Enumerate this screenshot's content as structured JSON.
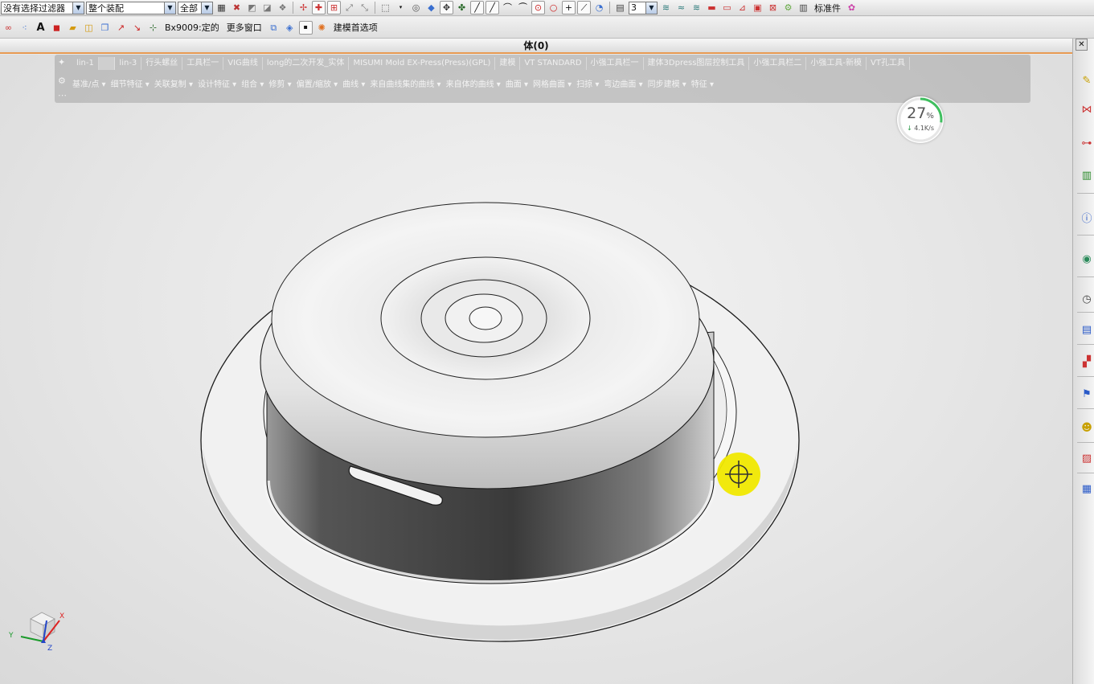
{
  "toolbar1": {
    "filter_value": "没有选择过滤器",
    "assembly_value": "整个装配",
    "scope_value": "全部",
    "layer_value": "3",
    "standard_parts_label": "标准件"
  },
  "toolbar2": {
    "macro_label": "Bx9009:定的",
    "more_windows_label": "更多窗口",
    "modeling_prefs_label": "建模首选项"
  },
  "window": {
    "title": "体(0)"
  },
  "ribbon": {
    "tabs": [
      "lin-1",
      "lin-3",
      "行头螺丝",
      "工具栏一",
      "VIG曲线",
      "long的二次开发_实体",
      "MISUMI Mold EX-Press(Press)(GPL)",
      "建模",
      "VT STANDARD",
      "小强工具栏一",
      "建体3Dpress图层控制工具",
      "小强工具栏二",
      "小强工具-新模",
      "VT孔工具"
    ],
    "groups": [
      "基准/点 ▾",
      "细节特征 ▾",
      "关联复制 ▾",
      "设计特征 ▾",
      "组合 ▾",
      "修剪 ▾",
      "偏置/缩放 ▾",
      "曲线 ▾",
      "来自曲线集的曲线 ▾",
      "来自体的曲线 ▾",
      "曲面 ▾",
      "网格曲面 ▾",
      "扫掠 ▾",
      "弯边曲面 ▾",
      "同步建模 ▾",
      "特征 ▾"
    ]
  },
  "download_badge": {
    "percent": 27,
    "percent_unit": "%",
    "speed": "4.1K/s",
    "arrow": "↓",
    "ring_color": "#3fbf5f"
  },
  "triad": {
    "x_label": "X",
    "y_label": "Y",
    "z_label": "Z"
  },
  "colors": {
    "accent_orange": "#e89a52",
    "cursor_yellow": "#f0e800"
  }
}
